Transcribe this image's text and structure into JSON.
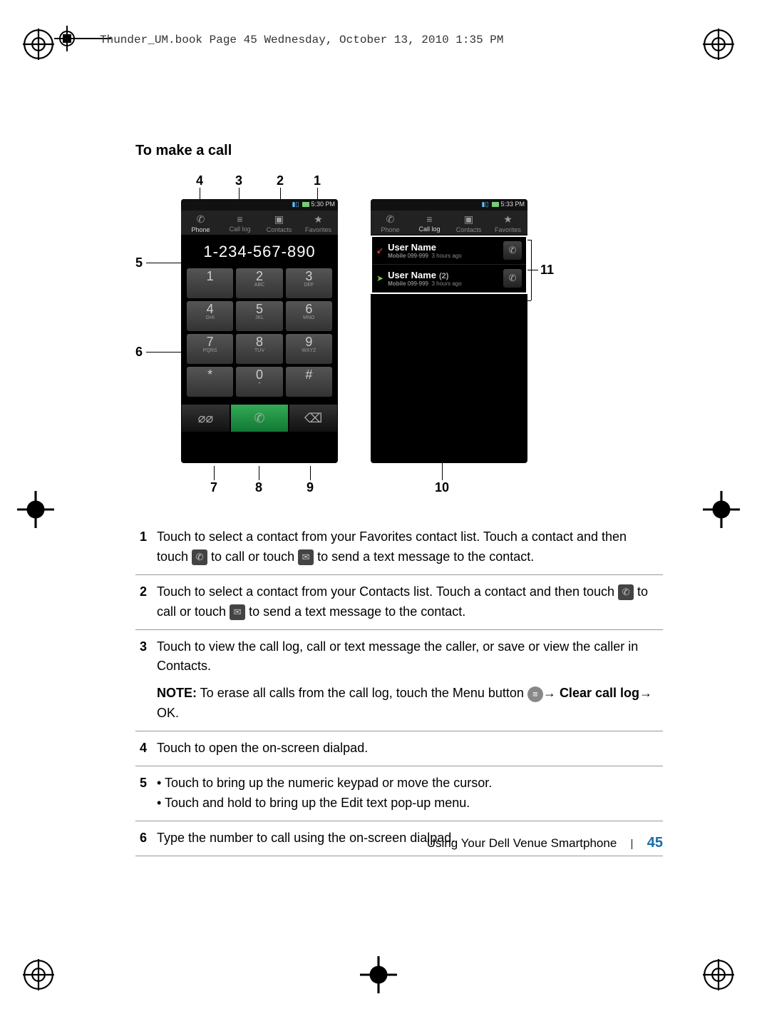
{
  "print_header": "Thunder_UM.book  Page 45  Wednesday, October 13, 2010  1:35 PM",
  "section_title": "To make a call",
  "callouts": {
    "c1": "1",
    "c2": "2",
    "c3": "3",
    "c4": "4",
    "c5": "5",
    "c6": "6",
    "c7": "7",
    "c8": "8",
    "c9": "9",
    "c10": "10",
    "c11": "11"
  },
  "phone_left": {
    "status_time": "5:30 PM",
    "tabs": {
      "phone": "Phone",
      "calllog": "Call log",
      "contacts": "Contacts",
      "favorites": "Favorites"
    },
    "dialed_number": "1-234-567-890",
    "keys": [
      {
        "n": "1",
        "s": ""
      },
      {
        "n": "2",
        "s": "ABC"
      },
      {
        "n": "3",
        "s": "DEF"
      },
      {
        "n": "4",
        "s": "GHI"
      },
      {
        "n": "5",
        "s": "JKL"
      },
      {
        "n": "6",
        "s": "MNO"
      },
      {
        "n": "7",
        "s": "PQRS"
      },
      {
        "n": "8",
        "s": "TUV"
      },
      {
        "n": "9",
        "s": "WXYZ"
      },
      {
        "n": "*",
        "s": ""
      },
      {
        "n": "0",
        "s": "+"
      },
      {
        "n": "#",
        "s": ""
      }
    ]
  },
  "phone_right": {
    "status_time": "5:33 PM",
    "tabs": {
      "phone": "Phone",
      "calllog": "Call log",
      "contacts": "Contacts",
      "favorites": "Favorites"
    },
    "rows": [
      {
        "name": "User Name",
        "type": "Mobile",
        "num": "099-999",
        "ago": "3 hours ago",
        "count": "",
        "dir": "miss"
      },
      {
        "name": "User Name",
        "type": "Mobile",
        "num": "099-999",
        "ago": "3 hours ago",
        "count": "(2)",
        "dir": "out"
      }
    ]
  },
  "table": {
    "r1": {
      "n": "1",
      "t1": "Touch to select a contact from your Favorites contact list. Touch a contact and then touch ",
      "t2": " to call or touch ",
      "t3": " to send a text message to the contact."
    },
    "r2": {
      "n": "2",
      "t1": "Touch to select a contact from your Contacts list. Touch a contact and then touch ",
      "t2": " to call or touch ",
      "t3": " to send a text message to the contact."
    },
    "r3": {
      "n": "3",
      "t1": "Touch to view the call log, call or text message the caller, or save or view the caller in Contacts.",
      "note_label": "NOTE:",
      "note_t1": " To erase all calls from the call log, touch the Menu button ",
      "note_t2": "→ ",
      "note_link": "Clear call log",
      "note_t3": "→ OK."
    },
    "r4": {
      "n": "4",
      "t": "Touch to open the on-screen dialpad."
    },
    "r5": {
      "n": "5",
      "b1": "Touch to bring up the numeric keypad or move the cursor.",
      "b2": "Touch and hold to bring up the Edit text pop-up menu."
    },
    "r6": {
      "n": "6",
      "t": "Type the number to call using the on-screen dialpad."
    }
  },
  "footer": {
    "text": "Using Your Dell Venue Smartphone",
    "page": "45"
  }
}
